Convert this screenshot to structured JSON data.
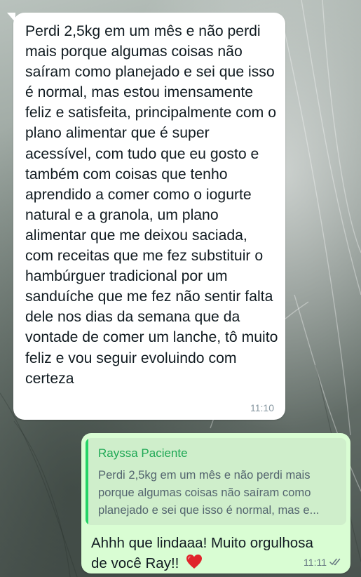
{
  "incoming": {
    "text": "Perdi 2,5kg em um mês e não perdi mais porque algumas coisas não saíram como planejado e sei que isso é normal, mas estou imensamente feliz e satisfeita, principalmente com o plano alimentar que é super acessível, com tudo que eu gosto e também com coisas que tenho aprendido a comer como o iogurte natural e a granola, um plano alimentar que me deixou saciada, com receitas que me fez substituir o hambúrguer tradicional por um sanduíche que me fez não sentir falta dele nos dias da semana que da vontade de comer um lanche, tô muito feliz e vou seguir evoluindo com certeza",
    "time": "11:10"
  },
  "outgoing": {
    "quote_author": "Rayssa Paciente",
    "quote_text": "Perdi 2,5kg em um mês e não perdi mais porque algumas coisas não saíram como planejado e sei que isso é normal, mas e...",
    "text": "Ahhh que lindaaa! Muito orgulhosa de você Ray!!",
    "time": "11:11",
    "heart_icon": "red-heart-icon",
    "status_icon": "read-checks-icon"
  },
  "colors": {
    "incoming_bubble": "#ffffff",
    "outgoing_bubble": "#d9fdd3",
    "quote_bar": "#25d366",
    "quote_author": "#1fa855",
    "heart": "#e0242b"
  }
}
